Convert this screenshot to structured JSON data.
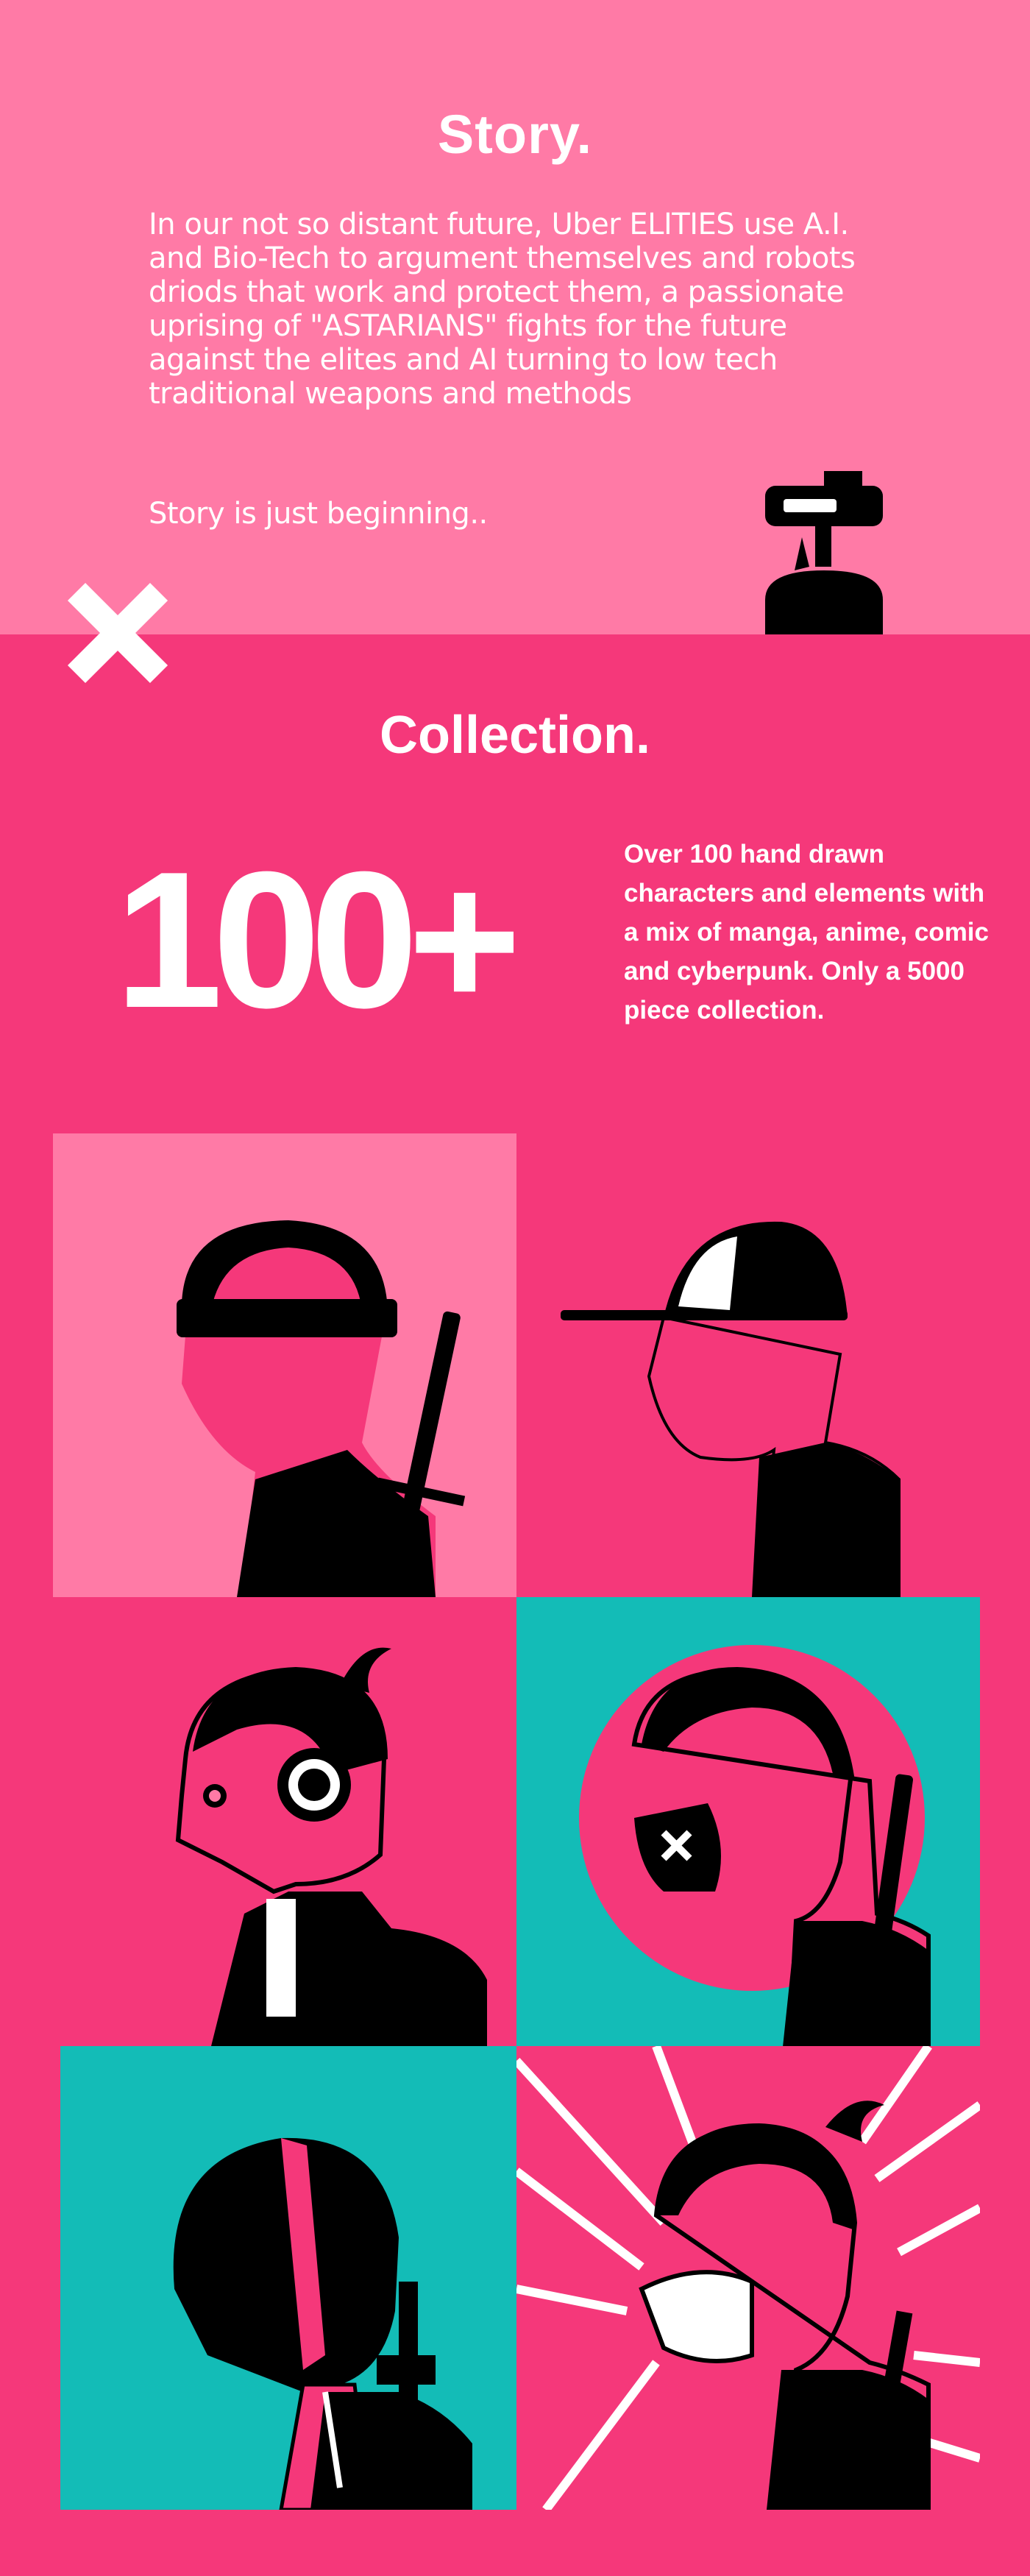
{
  "story": {
    "title": "Story.",
    "body": "In our not so distant future, Uber ELITIES use A.I. and Bio-Tech to argument themselves and robots driods that work and protect them, a passionate uprising of \"ASTARIANS\" fights for the future against the elites and AI turning to low tech traditional weapons and methods",
    "footer": "Story is just beginning.."
  },
  "collection": {
    "title": "Collection.",
    "count": "100+",
    "description": "Over 100 hand drawn characters and elements with a mix of manga, anime, comic and cyberpunk. Only a 5000 piece collection."
  },
  "icons": {
    "close": "close-x-icon",
    "robot": "robot-turret-illustration"
  },
  "colors": {
    "story_bg": "#ff7aa6",
    "collection_bg": "#f5387a",
    "teal": "#13bcb7",
    "ink": "#000000",
    "text": "#ffffff"
  }
}
